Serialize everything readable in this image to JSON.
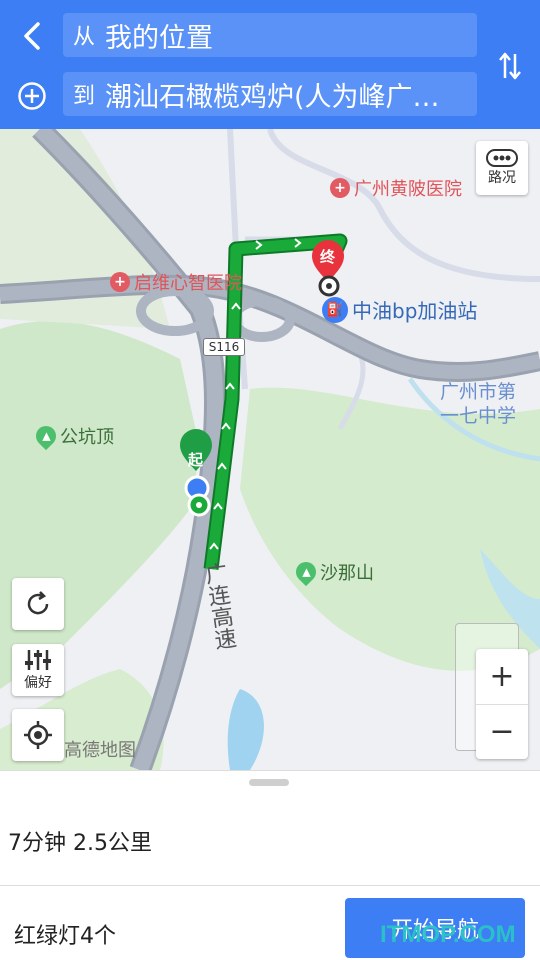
{
  "header": {
    "from_prefix": "从",
    "from_value": "我的位置",
    "to_prefix": "到",
    "to_value": "潮汕石橄榄鸡炉(人为峰广…"
  },
  "map": {
    "pois": {
      "hospital_huangpi": "广州黄陂医院",
      "hospital_qiwei": "启维心智医院",
      "gas_station": "中油bp加油站",
      "park_gongkeng": "公坑顶",
      "park_shana": "沙那山"
    },
    "school_line1": "广州市第",
    "school_line2": "一七中学",
    "road_shield": "S116",
    "highway_name": "广连高速",
    "start_marker": "起",
    "end_marker": "终",
    "logo_text": "高德地图",
    "route_color": "#1aaa3a",
    "traffic_label": "路况",
    "preference_label": "偏好",
    "zoom_in": "+",
    "zoom_out": "−"
  },
  "panel": {
    "summary": "7分钟 2.5公里",
    "traffic_lights": "红绿灯4个",
    "start_nav": "开始导航"
  },
  "watermark": "ITMOP.COM"
}
